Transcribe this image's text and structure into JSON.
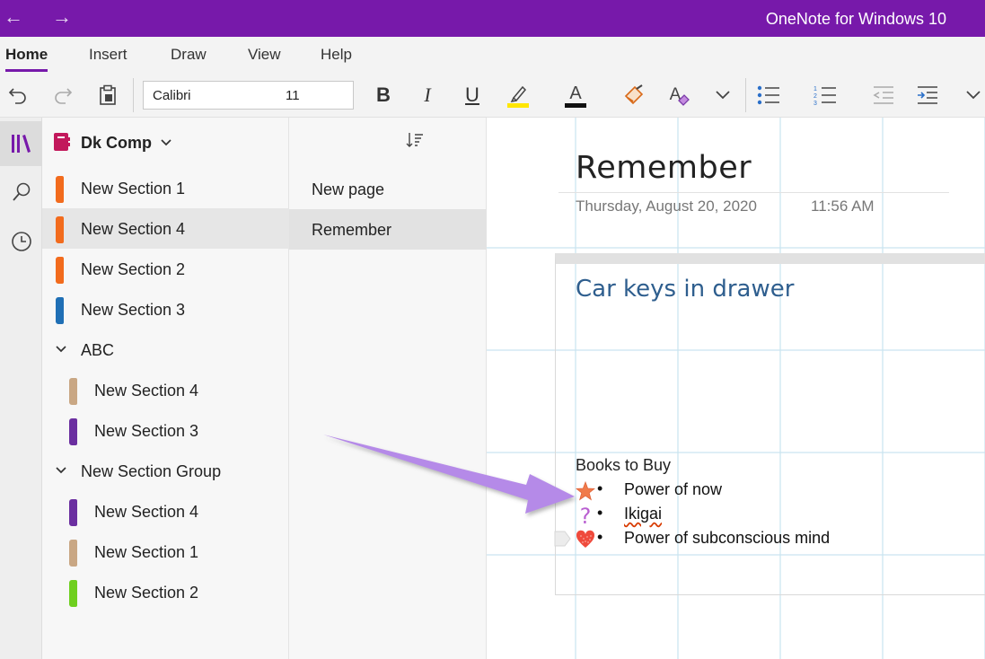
{
  "titlebar": {
    "app_title": "OneNote for Windows 10",
    "back_icon": "back-arrow-icon",
    "forward_icon": "forward-arrow-icon",
    "color": "#7719aa"
  },
  "ribbon": {
    "tabs": [
      {
        "label": "Home",
        "active": true
      },
      {
        "label": "Insert"
      },
      {
        "label": "Draw"
      },
      {
        "label": "View"
      },
      {
        "label": "Help"
      }
    ],
    "font_name": "Calibri",
    "font_size": "11",
    "bold": "B",
    "italic": "I",
    "underline": "U",
    "font_color_letter": "A",
    "highlight_color": "#ffe600",
    "font_color": "#111111"
  },
  "notebook": {
    "name": "Dk Comp",
    "icon": "notebook-icon",
    "color": "#c2185b"
  },
  "sections": [
    {
      "label": "New Section 1",
      "color": "#f26b1d"
    },
    {
      "label": "New Section 4",
      "color": "#f26b1d",
      "selected": true
    },
    {
      "label": "New Section 2",
      "color": "#f26b1d"
    },
    {
      "label": "New Section 3",
      "color": "#1f6fb5"
    },
    {
      "group": "ABC"
    },
    {
      "label": "New Section 4",
      "color": "#c9a784",
      "indent": true
    },
    {
      "label": "New Section 3",
      "color": "#6b2fa0",
      "indent": true
    },
    {
      "group": "New Section Group"
    },
    {
      "label": "New Section 4",
      "color": "#6b2fa0",
      "indent": true
    },
    {
      "label": "New Section 1",
      "color": "#c9a784",
      "indent": true
    },
    {
      "label": "New Section 2",
      "color": "#6fcf1f",
      "indent": true
    }
  ],
  "pages": [
    {
      "label": "New page"
    },
    {
      "label": "Remember",
      "selected": true
    }
  ],
  "page": {
    "title": "Remember",
    "date": "Thursday, August 20, 2020",
    "time": "11:56 AM",
    "heading": "Car keys in drawer",
    "list_title": "Books to Buy",
    "items": [
      {
        "text": "Power of now",
        "tag": "star-tag-icon"
      },
      {
        "text": "Ikigai",
        "tag": "question-tag-icon"
      },
      {
        "text": "Power of subconscious mind",
        "tag": "heart-tag-icon"
      }
    ],
    "bullet": "•"
  }
}
